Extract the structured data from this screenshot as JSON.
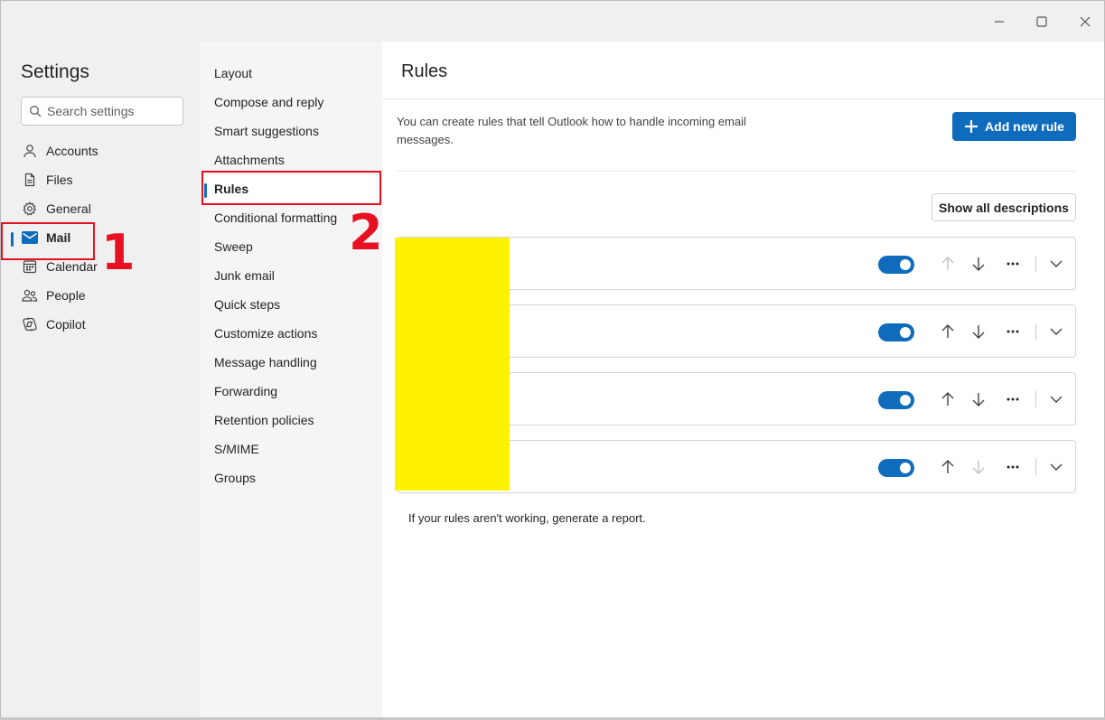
{
  "window": {
    "controls": [
      "minimize-icon",
      "maximize-icon",
      "close-icon"
    ]
  },
  "settings": {
    "title": "Settings",
    "search_placeholder": "Search settings",
    "items": [
      {
        "label": "Accounts",
        "icon": "person-icon"
      },
      {
        "label": "Files",
        "icon": "file-icon"
      },
      {
        "label": "General",
        "icon": "gear-icon"
      },
      {
        "label": "Mail",
        "icon": "mail-icon",
        "active": true
      },
      {
        "label": "Calendar",
        "icon": "calendar-icon"
      },
      {
        "label": "People",
        "icon": "people-icon"
      },
      {
        "label": "Copilot",
        "icon": "copilot-icon"
      }
    ]
  },
  "mail_settings": {
    "items": [
      {
        "label": "Layout"
      },
      {
        "label": "Compose and reply"
      },
      {
        "label": "Smart suggestions"
      },
      {
        "label": "Attachments"
      },
      {
        "label": "Rules",
        "active": true
      },
      {
        "label": "Conditional formatting"
      },
      {
        "label": "Sweep"
      },
      {
        "label": "Junk email"
      },
      {
        "label": "Quick steps"
      },
      {
        "label": "Customize actions"
      },
      {
        "label": "Message handling"
      },
      {
        "label": "Forwarding"
      },
      {
        "label": "Retention policies"
      },
      {
        "label": "S/MIME"
      },
      {
        "label": "Groups"
      }
    ]
  },
  "rules": {
    "title": "Rules",
    "description": "You can create rules that tell Outlook how to handle incoming email messages.",
    "add_label": "Add new rule",
    "show_all_label": "Show all descriptions",
    "items": [
      {
        "enabled": true,
        "move_up_enabled": false,
        "move_down_enabled": true
      },
      {
        "enabled": true,
        "move_up_enabled": true,
        "move_down_enabled": true
      },
      {
        "enabled": true,
        "move_up_enabled": true,
        "move_down_enabled": true
      },
      {
        "enabled": true,
        "move_up_enabled": true,
        "move_down_enabled": false
      }
    ],
    "report_text": "If your rules aren't working, generate a report."
  },
  "annotations": {
    "step1": "1",
    "step2": "2",
    "color": "#e81123"
  },
  "colors": {
    "accent": "#0f6cbd",
    "redaction": "#fff200"
  }
}
